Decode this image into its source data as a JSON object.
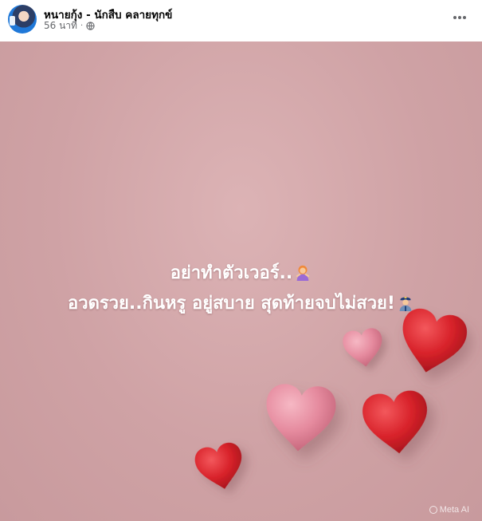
{
  "post": {
    "author_name": "หนายกุ้ง - นักสืบ คลายทุกข์",
    "timestamp": "56 นาที",
    "separator": "·",
    "privacy_icon": "globe-icon",
    "more_icon": "more-options-icon"
  },
  "image": {
    "caption_line_1": "อย่าทำตัวเวอร์..",
    "caption_line_1_emoji": "woman-gesturing-icon",
    "caption_line_2": "อวดรวย..กินหรู อยู่สบาย สุดท้ายจบไม่สวย!",
    "caption_line_2_emoji": "police-officer-icon",
    "watermark": "Meta AI",
    "colors": {
      "background": "#d2a8aa",
      "heart_red": "#d8222a",
      "heart_pink": "#e58a9e"
    }
  }
}
